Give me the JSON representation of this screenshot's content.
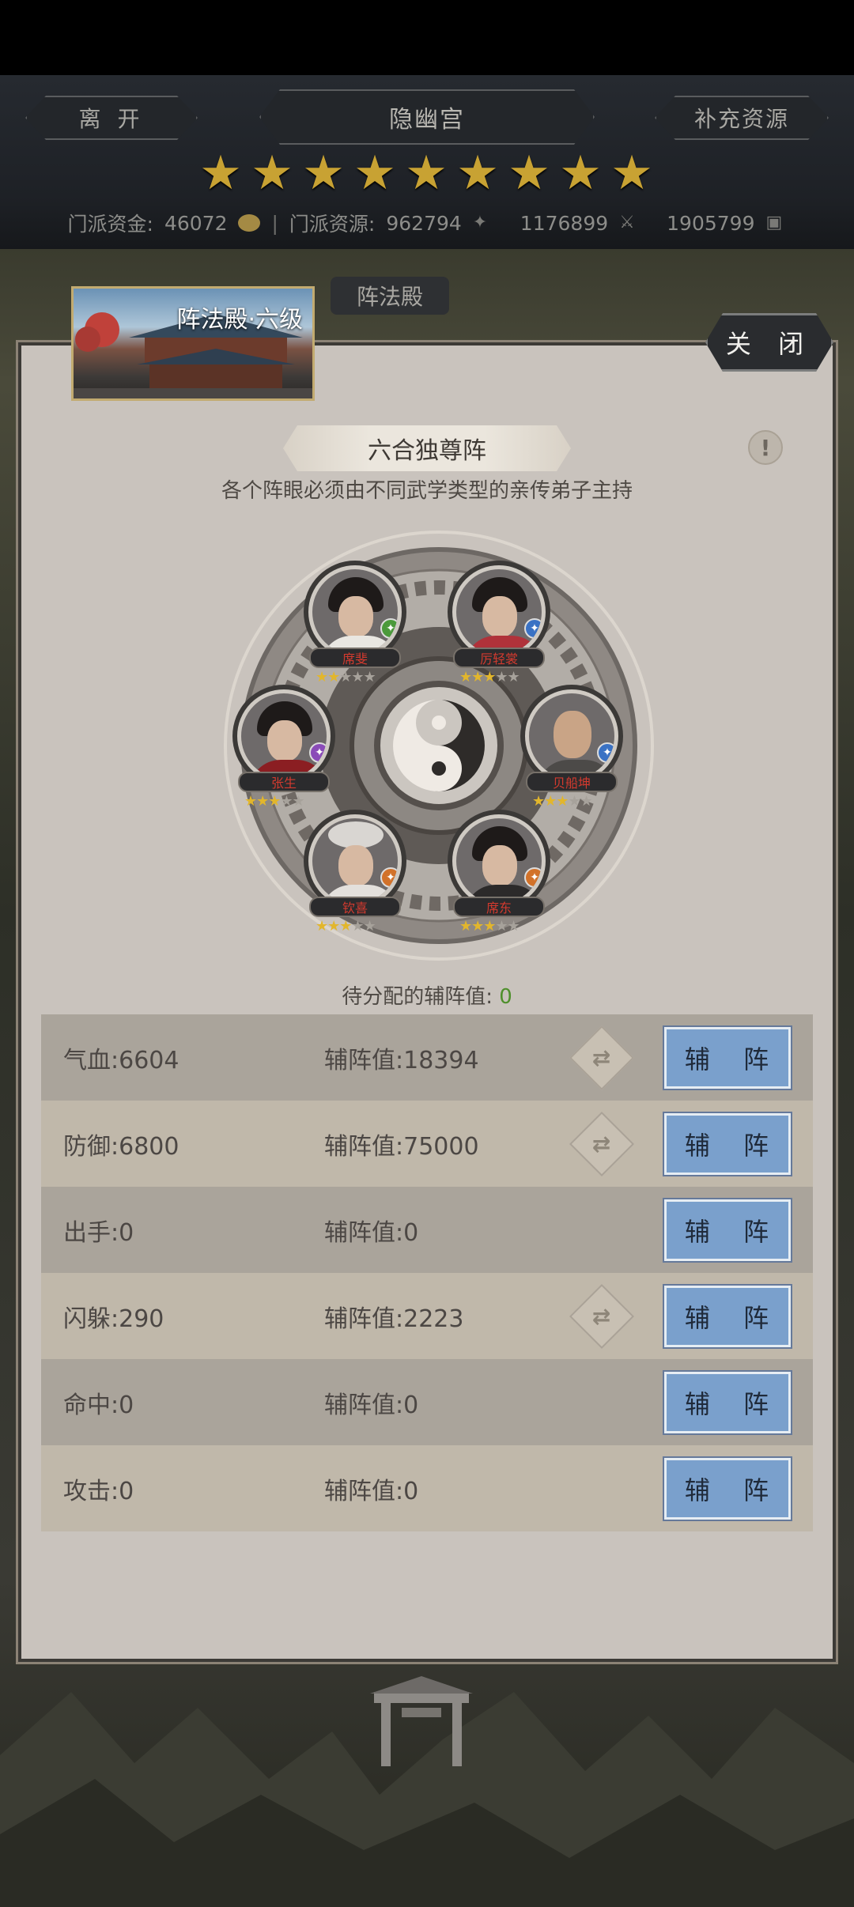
{
  "header": {
    "leave_label": "离 开",
    "sect_name": "隐幽宫",
    "replenish_label": "补充资源",
    "star_count": 9,
    "funds_label": "门派资金:",
    "funds_value": "46072",
    "resources_label": "门派资源:",
    "resources_value": "962794",
    "res2_value": "1176899",
    "res3_value": "1905799"
  },
  "tab": {
    "label": "阵法殿"
  },
  "building": {
    "title": "阵法殿·六级"
  },
  "close_label": "关 闭",
  "formation": {
    "name": "六合独尊阵",
    "info_icon": "!",
    "subtitle": "各个阵眼必须由不同武学类型的亲传弟子主持",
    "disciples": [
      {
        "name": "席斐",
        "stars": 2,
        "badge": "green"
      },
      {
        "name": "厉轻裳",
        "stars": 3,
        "badge": "blue"
      },
      {
        "name": "张生",
        "stars": 3,
        "badge": "purple"
      },
      {
        "name": "贝船坤",
        "stars": 3,
        "badge": "blue"
      },
      {
        "name": "钦喜",
        "stars": 3,
        "badge": "orange"
      },
      {
        "name": "席东",
        "stars": 3,
        "badge": "orange"
      }
    ]
  },
  "pending": {
    "label": "待分配的辅阵值:",
    "value": "0"
  },
  "rows": [
    {
      "stat": "气血:",
      "stat_value": "6604",
      "aux_label": "辅阵值:",
      "aux_value": "18394",
      "has_swap": true,
      "btn": "辅 阵"
    },
    {
      "stat": "防御:",
      "stat_value": "6800",
      "aux_label": "辅阵值:",
      "aux_value": "75000",
      "has_swap": true,
      "btn": "辅 阵"
    },
    {
      "stat": "出手:",
      "stat_value": "0",
      "aux_label": "辅阵值:",
      "aux_value": "0",
      "has_swap": false,
      "btn": "辅 阵"
    },
    {
      "stat": "闪躲:",
      "stat_value": "290",
      "aux_label": "辅阵值:",
      "aux_value": "2223",
      "has_swap": true,
      "btn": "辅 阵"
    },
    {
      "stat": "命中:",
      "stat_value": "0",
      "aux_label": "辅阵值:",
      "aux_value": "0",
      "has_swap": false,
      "btn": "辅 阵"
    },
    {
      "stat": "攻击:",
      "stat_value": "0",
      "aux_label": "辅阵值:",
      "aux_value": "0",
      "has_swap": false,
      "btn": "辅 阵"
    }
  ],
  "colors": {
    "accent_blue": "#7aa0cc",
    "gold": "#c8a233",
    "panel": "#c9c3bd"
  }
}
